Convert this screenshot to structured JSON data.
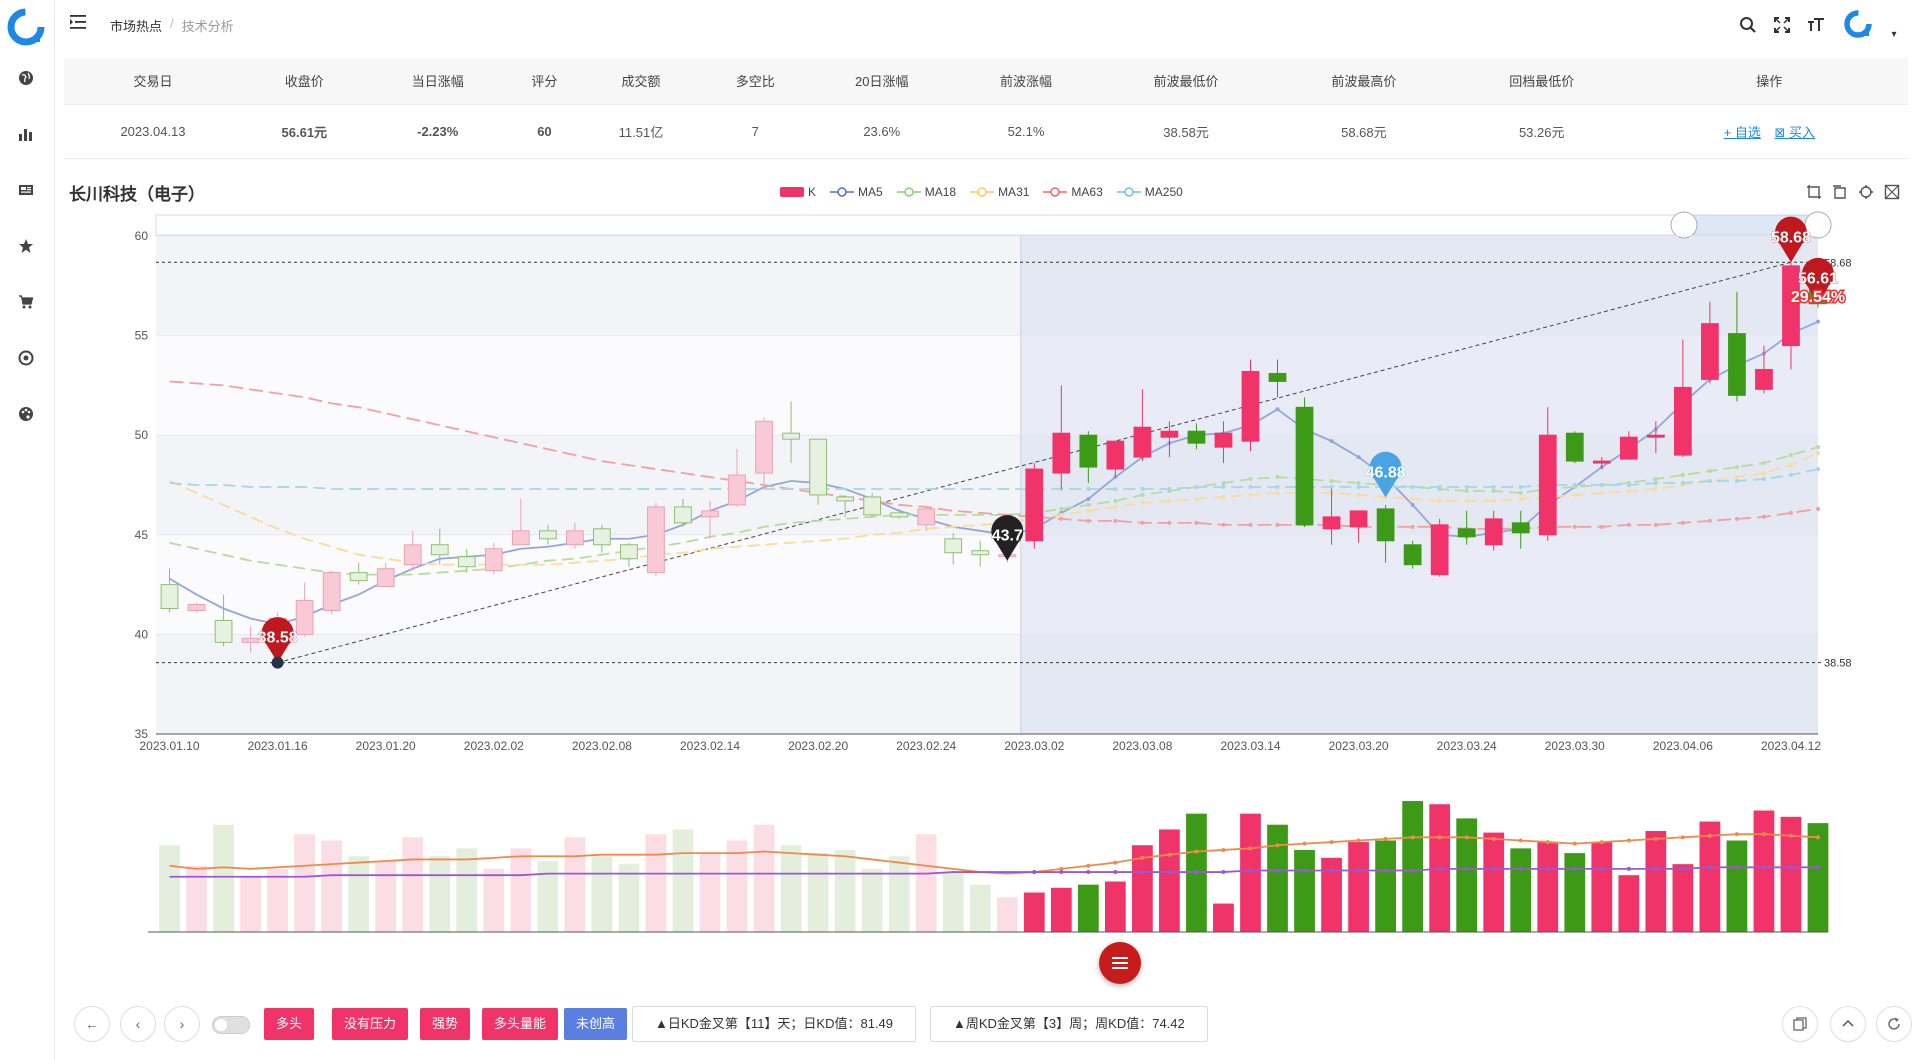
{
  "breadcrumb": [
    "市场热点",
    "技术分析"
  ],
  "table": {
    "headers": [
      "交易日",
      "收盘价",
      "当日涨幅",
      "评分",
      "成交额",
      "多空比",
      "20日涨幅",
      "前波涨幅",
      "前波最低价",
      "前波最高价",
      "回档最低价",
      "操作"
    ],
    "row": {
      "date": "2023.04.13",
      "close": "56.61元",
      "change": "-2.23%",
      "score": "60",
      "turnover": "11.51亿",
      "ratio": "7",
      "change20": "23.6%",
      "wave_change": "52.1%",
      "wave_low": "38.58元",
      "wave_high": "58.68元",
      "pullback_low": "53.26元",
      "op_watch": "+ 自选",
      "op_buy": "买入"
    }
  },
  "stock_name": "长川科技（电子）",
  "legend": [
    {
      "name": "K",
      "color": "#f0346a"
    },
    {
      "name": "MA5",
      "color": "#5470c6"
    },
    {
      "name": "MA18",
      "color": "#91cc75"
    },
    {
      "name": "MA31",
      "color": "#fac858"
    },
    {
      "name": "MA63",
      "color": "#ee6666"
    },
    {
      "name": "MA250",
      "color": "#73c0de"
    }
  ],
  "colors": {
    "up": "#f0346a",
    "down": "#3d9a17",
    "up_light": "#f9c9d6",
    "down_light": "#cfe6c3"
  },
  "chart_data": {
    "type": "candlestick",
    "ylim": [
      35,
      60
    ],
    "y_ticks": [
      35,
      40,
      45,
      50,
      55,
      60
    ],
    "x_tick_labels": [
      "2023.01.10",
      "2023.01.16",
      "2023.01.20",
      "2023.02.02",
      "2023.02.08",
      "2023.02.14",
      "2023.02.20",
      "2023.02.24",
      "2023.03.02",
      "2023.03.08",
      "2023.03.14",
      "2023.03.20",
      "2023.03.24",
      "2023.03.30",
      "2023.04.06",
      "2023.04.12"
    ],
    "ohlc": [
      [
        42.5,
        41.3,
        43.3,
        41.1
      ],
      [
        41.2,
        41.5,
        41.6,
        41.1
      ],
      [
        40.7,
        39.6,
        42.0,
        39.4
      ],
      [
        39.6,
        39.8,
        40.4,
        39.1
      ],
      [
        39.5,
        40.8,
        41.1,
        39.3
      ],
      [
        40.0,
        41.7,
        42.6,
        39.9
      ],
      [
        41.2,
        43.1,
        43.2,
        41.0
      ],
      [
        43.1,
        42.7,
        43.6,
        42.5
      ],
      [
        42.4,
        43.3,
        43.6,
        42.4
      ],
      [
        43.5,
        44.5,
        45.2,
        43.2
      ],
      [
        44.5,
        44.0,
        45.3,
        43.5
      ],
      [
        43.9,
        43.4,
        44.3,
        43.1
      ],
      [
        43.2,
        44.3,
        44.6,
        43.0
      ],
      [
        44.5,
        45.2,
        46.8,
        44.5
      ],
      [
        45.2,
        44.8,
        45.5,
        44.5
      ],
      [
        44.5,
        45.2,
        45.6,
        44.3
      ],
      [
        45.3,
        44.5,
        45.5,
        44.1
      ],
      [
        44.5,
        43.8,
        44.6,
        43.4
      ],
      [
        43.1,
        46.4,
        46.6,
        42.9
      ],
      [
        46.4,
        45.6,
        46.8,
        45.4
      ],
      [
        45.9,
        46.2,
        46.7,
        44.8
      ],
      [
        46.5,
        48.0,
        49.3,
        46.4
      ],
      [
        48.1,
        50.7,
        50.9,
        47.3
      ],
      [
        50.1,
        49.8,
        51.7,
        48.6
      ],
      [
        49.8,
        47.0,
        49.8,
        46.5
      ],
      [
        46.9,
        46.7,
        47.0,
        45.9
      ],
      [
        46.9,
        46.0,
        47.1,
        45.9
      ],
      [
        46.1,
        45.9,
        46.3,
        45.8
      ],
      [
        45.5,
        46.3,
        46.4,
        45.2
      ],
      [
        44.8,
        44.1,
        45.1,
        43.5
      ],
      [
        44.2,
        44.0,
        44.7,
        43.4
      ],
      [
        43.9,
        44.0,
        44.0,
        43.6
      ],
      [
        44.7,
        48.3,
        48.6,
        44.3
      ],
      [
        48.1,
        50.1,
        52.5,
        47.3
      ],
      [
        50.0,
        48.4,
        50.2,
        47.6
      ],
      [
        48.3,
        49.7,
        49.7,
        47.9
      ],
      [
        48.9,
        50.4,
        52.3,
        48.7
      ],
      [
        49.9,
        50.2,
        50.7,
        48.9
      ],
      [
        50.2,
        49.6,
        50.6,
        49.3
      ],
      [
        49.4,
        50.1,
        50.7,
        48.6
      ],
      [
        49.7,
        53.2,
        53.8,
        49.2
      ],
      [
        53.1,
        52.7,
        53.8,
        51.9
      ],
      [
        51.4,
        45.5,
        51.9,
        45.4
      ],
      [
        45.3,
        45.9,
        47.3,
        44.5
      ],
      [
        45.4,
        46.2,
        46.2,
        44.6
      ],
      [
        46.3,
        44.7,
        46.5,
        43.6
      ],
      [
        44.5,
        43.5,
        44.7,
        43.3
      ],
      [
        43.0,
        45.5,
        45.8,
        42.9
      ],
      [
        45.3,
        44.9,
        46.2,
        44.5
      ],
      [
        44.5,
        45.8,
        46.2,
        44.2
      ],
      [
        45.6,
        45.1,
        46.2,
        44.3
      ],
      [
        45.0,
        50.0,
        51.4,
        44.7
      ],
      [
        50.1,
        48.7,
        50.2,
        48.6
      ],
      [
        48.6,
        48.7,
        48.9,
        48.3
      ],
      [
        48.8,
        49.9,
        50.2,
        48.8
      ],
      [
        49.9,
        50.0,
        50.7,
        49.1
      ],
      [
        49.0,
        52.4,
        54.8,
        48.9
      ],
      [
        52.8,
        55.6,
        56.7,
        52.6
      ],
      [
        55.1,
        52.0,
        57.2,
        51.7
      ],
      [
        52.3,
        53.3,
        54.5,
        52.1
      ],
      [
        54.5,
        58.5,
        58.7,
        53.3
      ],
      [
        57.9,
        56.6,
        58.3,
        56.4
      ]
    ],
    "ma": {
      "MA5": [
        42.8,
        42.0,
        41.3,
        40.8,
        40.5,
        40.9,
        41.5,
        42.0,
        42.7,
        43.3,
        43.8,
        43.9,
        44.0,
        44.3,
        44.4,
        44.6,
        44.8,
        44.8,
        45.0,
        45.5,
        46.2,
        46.7,
        47.4,
        47.7,
        47.6,
        47.3,
        46.8,
        46.2,
        45.8,
        45.4,
        45.2,
        45.0,
        45.3,
        46.1,
        46.8,
        47.9,
        48.9,
        49.6,
        50.0,
        50.1,
        50.5,
        51.3,
        50.3,
        49.7,
        48.9,
        47.9,
        46.5,
        45.0,
        44.9,
        45.1,
        45.3,
        46.5,
        47.4,
        48.4,
        49.3,
        50.3,
        51.6,
        52.8,
        53.5,
        54.1,
        55.1,
        55.7
      ],
      "MA18": [
        44.6,
        44.3,
        44.0,
        43.7,
        43.5,
        43.3,
        43.1,
        43.0,
        43.0,
        43.0,
        43.1,
        43.2,
        43.3,
        43.5,
        43.7,
        43.8,
        44.0,
        44.2,
        44.4,
        44.6,
        44.9,
        45.1,
        45.4,
        45.6,
        45.7,
        45.8,
        45.9,
        46.0,
        46.0,
        46.0,
        46.0,
        46.0,
        46.1,
        46.3,
        46.5,
        46.7,
        47.0,
        47.2,
        47.4,
        47.6,
        47.8,
        47.9,
        47.8,
        47.7,
        47.6,
        47.5,
        47.4,
        47.3,
        47.2,
        47.2,
        47.1,
        47.3,
        47.4,
        47.5,
        47.6,
        47.8,
        48.0,
        48.2,
        48.4,
        48.6,
        49.0,
        49.4
      ],
      "MA31": [
        47.7,
        47.1,
        46.5,
        45.9,
        45.3,
        44.8,
        44.4,
        44.0,
        43.8,
        43.6,
        43.5,
        43.5,
        43.5,
        43.5,
        43.5,
        43.6,
        43.7,
        43.8,
        44.0,
        44.1,
        44.3,
        44.4,
        44.5,
        44.6,
        44.7,
        44.8,
        45.0,
        45.1,
        45.3,
        45.4,
        45.5,
        45.6,
        45.8,
        46.0,
        46.2,
        46.4,
        46.6,
        46.7,
        46.8,
        46.9,
        47.0,
        47.1,
        47.1,
        47.1,
        47.0,
        46.9,
        46.8,
        46.7,
        46.7,
        46.7,
        46.8,
        46.9,
        47.0,
        47.1,
        47.2,
        47.3,
        47.5,
        47.7,
        47.9,
        48.1,
        48.5,
        49.1
      ],
      "MA63": [
        52.7,
        52.6,
        52.5,
        52.3,
        52.1,
        51.9,
        51.6,
        51.4,
        51.1,
        50.8,
        50.5,
        50.2,
        49.9,
        49.6,
        49.3,
        49.0,
        48.7,
        48.5,
        48.3,
        48.1,
        47.9,
        47.7,
        47.5,
        47.3,
        47.1,
        46.9,
        46.7,
        46.5,
        46.4,
        46.2,
        46.1,
        46.0,
        45.9,
        45.8,
        45.7,
        45.7,
        45.6,
        45.6,
        45.6,
        45.5,
        45.5,
        45.5,
        45.5,
        45.5,
        45.4,
        45.4,
        45.4,
        45.4,
        45.3,
        45.3,
        45.3,
        45.4,
        45.4,
        45.4,
        45.5,
        45.5,
        45.6,
        45.7,
        45.8,
        45.9,
        46.1,
        46.3
      ],
      "MA250": [
        47.6,
        47.5,
        47.5,
        47.4,
        47.4,
        47.4,
        47.3,
        47.3,
        47.3,
        47.3,
        47.3,
        47.3,
        47.3,
        47.3,
        47.3,
        47.3,
        47.3,
        47.3,
        47.3,
        47.3,
        47.3,
        47.3,
        47.3,
        47.3,
        47.3,
        47.3,
        47.3,
        47.3,
        47.3,
        47.3,
        47.3,
        47.3,
        47.3,
        47.3,
        47.3,
        47.3,
        47.3,
        47.3,
        47.4,
        47.4,
        47.4,
        47.4,
        47.4,
        47.4,
        47.4,
        47.4,
        47.4,
        47.4,
        47.4,
        47.4,
        47.4,
        47.5,
        47.5,
        47.5,
        47.5,
        47.6,
        47.6,
        47.7,
        47.7,
        47.8,
        48.0,
        48.3
      ]
    },
    "volume": [
      55,
      42,
      68,
      35,
      40,
      62,
      58,
      48,
      45,
      60,
      48,
      53,
      40,
      53,
      45,
      60,
      48,
      43,
      62,
      65,
      50,
      58,
      68,
      55,
      50,
      52,
      40,
      48,
      62,
      38,
      30,
      22,
      25,
      28,
      30,
      32,
      55,
      65,
      75,
      18,
      75,
      68,
      52,
      47,
      57,
      58,
      83,
      81,
      72,
      63,
      53,
      57,
      50,
      57,
      36,
      64,
      43,
      70,
      58,
      77,
      73,
      69,
      62,
      73,
      64,
      68
    ],
    "volume_ma": [
      42,
      40,
      41,
      40,
      41,
      42,
      43,
      44,
      45,
      46,
      46,
      46,
      47,
      48,
      48,
      48,
      49,
      49,
      49,
      50,
      50,
      50,
      51,
      50,
      49,
      48,
      46,
      44,
      42,
      40,
      38,
      37,
      38,
      40,
      42,
      44,
      47,
      49,
      51,
      52,
      53,
      55,
      56,
      57,
      58,
      59,
      60,
      60,
      60,
      59,
      58,
      57,
      56,
      57,
      58,
      59,
      60,
      61,
      62,
      62,
      61,
      60
    ],
    "volume_ma2": [
      35,
      35,
      35,
      35,
      35,
      35,
      36,
      36,
      36,
      36,
      36,
      36,
      36,
      36,
      37,
      37,
      37,
      37,
      37,
      37,
      37,
      37,
      37,
      37,
      37,
      37,
      37,
      37,
      37,
      38,
      38,
      38,
      38,
      38,
      38,
      38,
      38,
      38,
      38,
      38,
      39,
      39,
      39,
      39,
      39,
      39,
      39,
      40,
      40,
      40,
      40,
      40,
      40,
      40,
      40,
      40,
      40,
      41,
      41,
      41,
      41,
      41
    ],
    "markers": [
      {
        "label": "38.58",
        "index": 4,
        "value": 38.58,
        "color": "#c0181f"
      },
      {
        "label": "43.7",
        "index": 31,
        "value": 43.7,
        "color": "#222"
      },
      {
        "label": "46.88",
        "index": 45,
        "value": 46.88,
        "color": "#4aa3e2"
      },
      {
        "label": "58.68",
        "index": 60,
        "value": 58.68,
        "color": "#c0181f"
      },
      {
        "label": "56.61",
        "index": 61,
        "value": 56.61,
        "color": "#c0181f"
      },
      {
        "label": "29.54%",
        "index": 61,
        "value": 56.9,
        "color": "#e33"
      }
    ],
    "ref_lines": [
      {
        "label": "58.68",
        "value": 58.68
      },
      {
        "label": "38.58",
        "value": 38.58
      }
    ],
    "highlight_start_index": 32
  },
  "signals": {
    "tags": [
      {
        "label": "多头",
        "color": "#f0346a"
      },
      {
        "label": "没有压力",
        "color": "#f0346a"
      },
      {
        "label": "强势",
        "color": "#f0346a"
      },
      {
        "label": "多头量能",
        "color": "#f0346a"
      },
      {
        "label": "未创高",
        "color": "#5b7fe0"
      }
    ],
    "daily_kd": "▲日KD金叉第【11】天；日KD值：81.49",
    "weekly_kd": "▲周KD金叉第【3】周；周KD值：74.42"
  },
  "icons": {
    "sidebar": [
      "globe-icon",
      "bar-chart-icon",
      "newspaper-icon",
      "star-icon",
      "cart-icon",
      "target-icon",
      "palette-icon"
    ],
    "top": [
      "search-icon",
      "fullscreen-icon",
      "font-size-icon"
    ]
  }
}
